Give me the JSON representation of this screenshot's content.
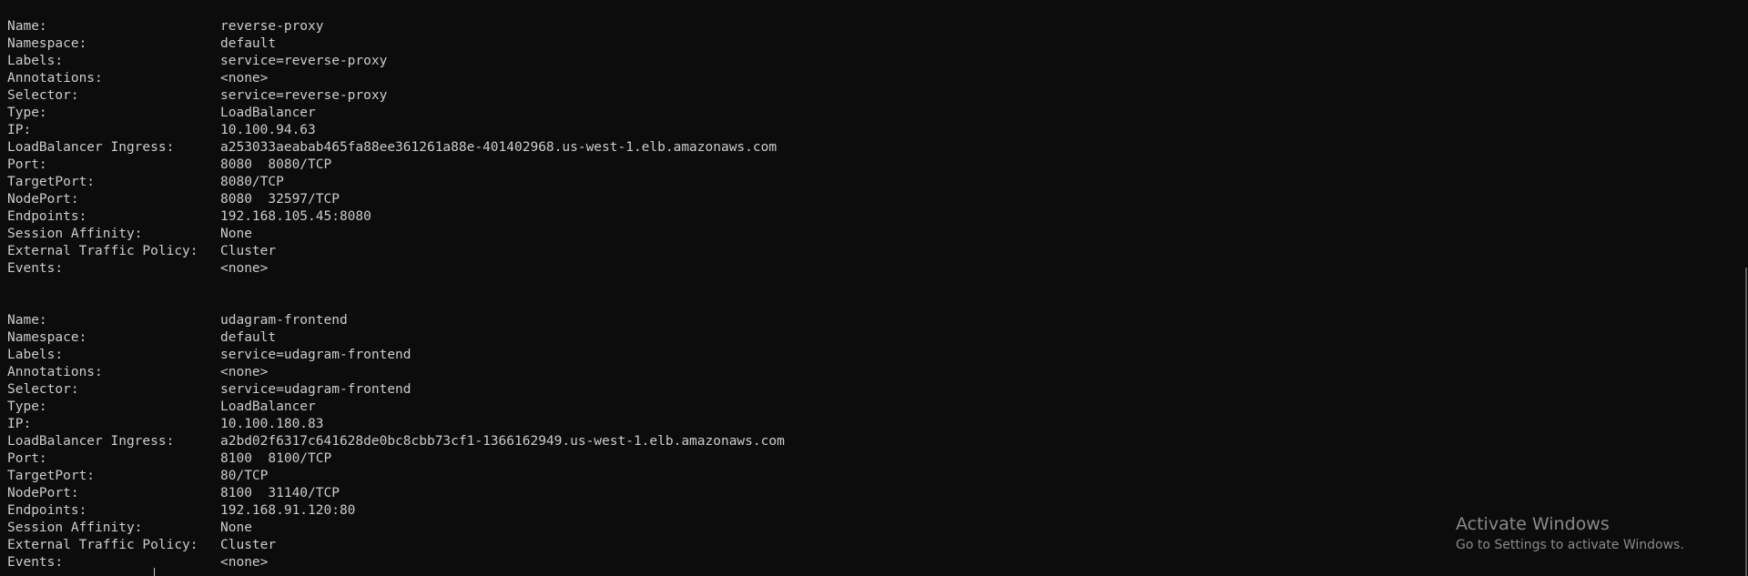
{
  "services": [
    {
      "fields": [
        {
          "key": "Name:",
          "value": "reverse-proxy"
        },
        {
          "key": "Namespace:",
          "value": "default"
        },
        {
          "key": "Labels:",
          "value": "service=reverse-proxy"
        },
        {
          "key": "Annotations:",
          "value": "<none>"
        },
        {
          "key": "Selector:",
          "value": "service=reverse-proxy"
        },
        {
          "key": "Type:",
          "value": "LoadBalancer"
        },
        {
          "key": "IP:",
          "value": "10.100.94.63"
        },
        {
          "key": "LoadBalancer Ingress:",
          "value": "a253033aeabab465fa88ee361261a88e-401402968.us-west-1.elb.amazonaws.com"
        },
        {
          "key": "Port:",
          "value": "8080  8080/TCP"
        },
        {
          "key": "TargetPort:",
          "value": "8080/TCP"
        },
        {
          "key": "NodePort:",
          "value": "8080  32597/TCP"
        },
        {
          "key": "Endpoints:",
          "value": "192.168.105.45:8080"
        },
        {
          "key": "Session Affinity:",
          "value": "None"
        },
        {
          "key": "External Traffic Policy:",
          "value": "Cluster"
        },
        {
          "key": "Events:",
          "value": "<none>"
        }
      ]
    },
    {
      "fields": [
        {
          "key": "Name:",
          "value": "udagram-frontend"
        },
        {
          "key": "Namespace:",
          "value": "default"
        },
        {
          "key": "Labels:",
          "value": "service=udagram-frontend"
        },
        {
          "key": "Annotations:",
          "value": "<none>"
        },
        {
          "key": "Selector:",
          "value": "service=udagram-frontend"
        },
        {
          "key": "Type:",
          "value": "LoadBalancer"
        },
        {
          "key": "IP:",
          "value": "10.100.180.83"
        },
        {
          "key": "LoadBalancer Ingress:",
          "value": "a2bd02f6317c641628de0bc8cbb73cf1-1366162949.us-west-1.elb.amazonaws.com"
        },
        {
          "key": "Port:",
          "value": "8100  8100/TCP"
        },
        {
          "key": "TargetPort:",
          "value": "80/TCP"
        },
        {
          "key": "NodePort:",
          "value": "8100  31140/TCP"
        },
        {
          "key": "Endpoints:",
          "value": "192.168.91.120:80"
        },
        {
          "key": "Session Affinity:",
          "value": "None"
        },
        {
          "key": "External Traffic Policy:",
          "value": "Cluster"
        },
        {
          "key": "Events:",
          "value": "<none>"
        }
      ]
    }
  ],
  "watermark": {
    "title": "Activate Windows",
    "subtitle": "Go to Settings to activate Windows."
  },
  "colors": {
    "background": "#0c0c0c",
    "foreground": "#cccccc",
    "watermark": "#8a8a8a"
  }
}
